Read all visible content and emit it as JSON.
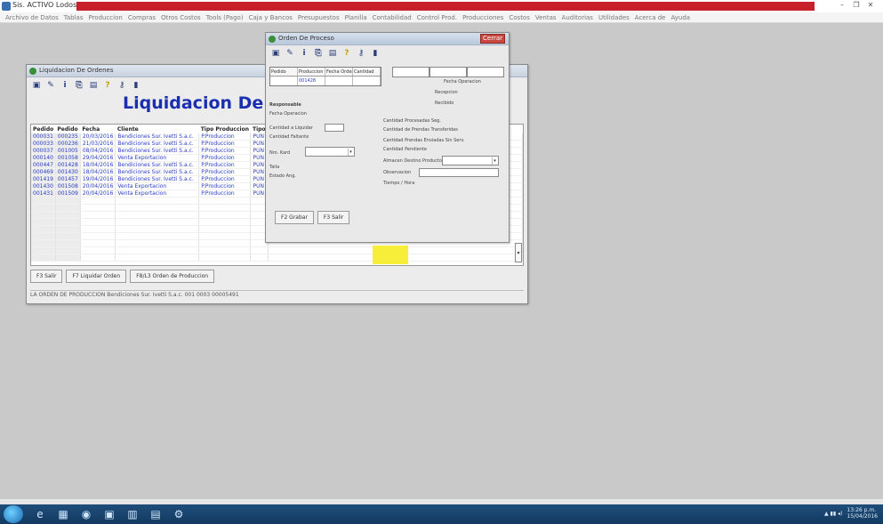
{
  "app": {
    "title": "Sis. ACTIVO Lodoso",
    "band_left": "",
    "band_right": ""
  },
  "liquidacion": {
    "window_title": "Liquidacion De Ordenes",
    "heading": "Liquidacion De Or",
    "columns": [
      "Pedido",
      "Pedido",
      "Fecha",
      "Cliente",
      "Tipo Produccion",
      "Tipo"
    ],
    "rows": [
      [
        "000031",
        "000235",
        "20/03/2016",
        "Bendiciones Sur. Ivetti S.a.c.",
        "P.Produccion",
        "PUN"
      ],
      [
        "000033",
        "000236",
        "21/03/2016",
        "Bendiciones Sur. Ivetti S.a.c.",
        "P.Produccion",
        "PUN"
      ],
      [
        "000037",
        "001005",
        "08/04/2016",
        "Bendiciones Sur. Ivetti S.a.c.",
        "P.Produccion",
        "PUN"
      ],
      [
        "000140",
        "001058",
        "29/04/2016",
        "Venta Exportacion",
        "P.Produccion",
        "PUN"
      ],
      [
        "000447",
        "001428",
        "18/04/2016",
        "Bendiciones Sur. Ivetti S.a.c.",
        "P.Produccion",
        "PUN"
      ],
      [
        "000469",
        "001430",
        "18/04/2016",
        "Bendiciones Sur. Ivetti S.a.c.",
        "P.Produccion",
        "PUN"
      ],
      [
        "001419",
        "001457",
        "19/04/2016",
        "Bendiciones Sur. Ivetti S.a.c.",
        "P.Produccion",
        "PUN"
      ],
      [
        "001430",
        "001508",
        "20/04/2016",
        "Venta Exportacion",
        "P.Produccion",
        "PUN"
      ],
      [
        "001431",
        "001509",
        "20/04/2016",
        "Venta Exportacion",
        "P.Produccion",
        "PUN"
      ]
    ],
    "buttons": {
      "close": "F3 Salir",
      "print": "F7 Liquidar Orden",
      "order": "F8/L3 Orden de Produccion"
    },
    "status": "LA ORDEN DE PRODUCCION Bendiciones Sur. Ivetti S.a.c. 001 0003 00005491"
  },
  "dialog": {
    "window_title": "Orden De Proceso",
    "close_label": "Cerrar",
    "header_cols": [
      "Pedido",
      "Produccion",
      "Fecha Orden",
      "Cantidad"
    ],
    "header_vals": [
      "",
      "001428",
      "",
      ""
    ],
    "right_labels": {
      "fecha_operacion": "Fecha Operacion",
      "recepcion": "Recepcion",
      "recibido": "Recibido"
    },
    "left_fields": {
      "section": "Responsable",
      "f1": "Fecha Operacion",
      "f2": "Cantidad a Liquidar",
      "f3": "Cantidad Faltante",
      "f4": "Nro. Kard",
      "f5": "Talla",
      "f6": "Estado Ang."
    },
    "right_fields": {
      "r1": "Cantidad Procesadas Seg.",
      "r2": "Cantidad de Prendas Transferidas",
      "r3": "Cantidad Prendas Enviadas Sin Serv.",
      "r4": "Cantidad Pendiente",
      "r5": "Almacen Destino Producto",
      "r6": "Observacion",
      "r7": "Tiempo / Hora"
    },
    "buttons": {
      "grabar": "F2 Grabar",
      "salir": "F3 Salir"
    }
  },
  "menubar": [
    "Archivo de Datos",
    "Tablas",
    "Produccion",
    "Compras",
    "Otros Costos",
    "Tools (Pago)",
    "Caja y Bancos",
    "Presupuestos",
    "Planilla",
    "Contabilidad",
    "Control Prod.",
    "Producciones",
    "Costos",
    "Ventas",
    "Auditorias",
    "Utilidades",
    "Acerca de",
    "Ayuda"
  ],
  "taskbar": {
    "time": "13:26 p.m.",
    "date": "15/04/2016"
  }
}
